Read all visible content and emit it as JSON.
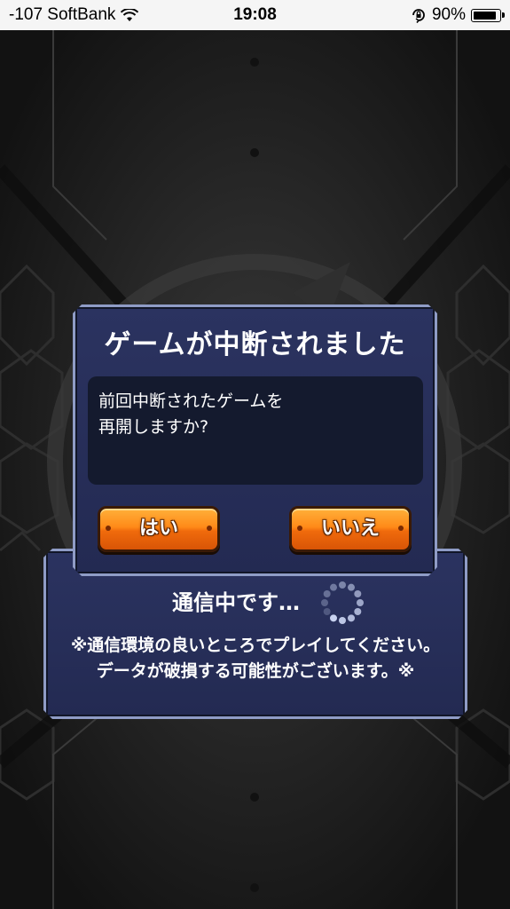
{
  "status_bar": {
    "carrier": "-107 SoftBank",
    "time": "19:08",
    "battery_percent": "90%",
    "battery_level": 0.9
  },
  "comm_panel": {
    "title": "通信中です…",
    "note_line1": "※通信環境の良いところでプレイしてください。",
    "note_line2": "データが破損する可能性がございます。※"
  },
  "dialog": {
    "title": "ゲームが中断されました",
    "message_line1": "前回中断されたゲームを",
    "message_line2": "再開しますか?",
    "yes_label": "はい",
    "no_label": "いいえ"
  },
  "colors": {
    "panel": "#2b3360",
    "panel_border": "#8f9cc6",
    "button": "#ff8a18",
    "message_bg": "#141a2e"
  }
}
